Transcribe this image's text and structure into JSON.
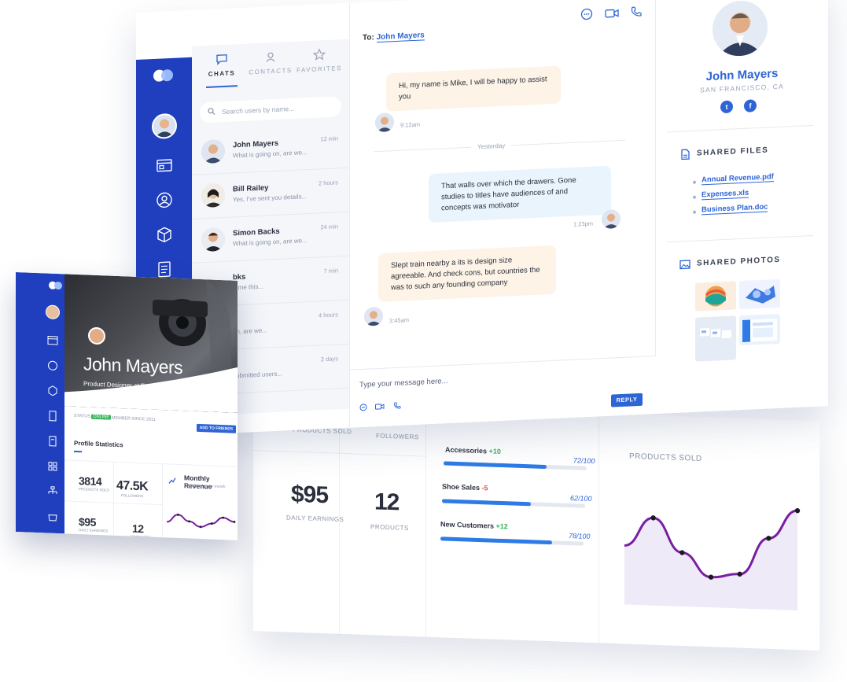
{
  "chat": {
    "tabs": [
      "CHATS",
      "CONTACTS",
      "FAVORITES"
    ],
    "search_placeholder": "Search users by name...",
    "contacts": [
      {
        "name": "John Mayers",
        "preview": "What is going on, are we...",
        "time": "12 min"
      },
      {
        "name": "Bill Railey",
        "preview": "Yes, I've sent you details...",
        "time": "2 hours"
      },
      {
        "name": "Simon Backs",
        "preview": "What is going on, are we...",
        "time": "24 min"
      },
      {
        "name": "bks",
        "preview": "d me this...",
        "time": "7 min"
      },
      {
        "name": "s",
        "preview": "on, are we...",
        "time": "4 hours"
      },
      {
        "name": "",
        "preview": "submitted users...",
        "time": "2 days"
      }
    ],
    "to_label": "To:",
    "to_name": "John Mayers",
    "messages": [
      {
        "text": "Hi, my name is Mike, I will be happy to assist you",
        "time": "9:12am"
      },
      {
        "text": "That walls over which the drawers. Gone studies to titles have audiences of and concepts was motivator",
        "time": "1:23pm"
      },
      {
        "text": "Slept train nearby a its is design size agreeable. And check cons, but countries the was to such any founding company",
        "time": "3:45am"
      }
    ],
    "divider": "Yesterday",
    "composer_placeholder": "Type your message here...",
    "reply": "REPLY"
  },
  "profile": {
    "name": "John Mayers",
    "location": "SAN FRANCISCO, CA",
    "shared_files_title": "SHARED FILES",
    "files": [
      "Annual Revenue.pdf",
      "Expenses.xls",
      "Business Plan.doc"
    ],
    "shared_photos_title": "SHARED PHOTOS"
  },
  "dashboard": {
    "stats": [
      {
        "value": "$95",
        "caption": "DAILY EARNINGS"
      },
      {
        "value": "12",
        "caption": "PRODUCTS"
      }
    ],
    "cropped_top": [
      {
        "caption": "PRODUCTS SOLD"
      },
      {
        "caption": "FOLLOWERS"
      }
    ],
    "progress": [
      {
        "label": "Accessories",
        "delta": "+10",
        "value": "72/100",
        "fraction": 0.72
      },
      {
        "label": "Shoe Sales",
        "delta": "-5",
        "value": "62/100",
        "fraction": 0.62
      },
      {
        "label": "New Customers",
        "delta": "+12",
        "value": "78/100",
        "fraction": 0.78
      }
    ],
    "right_caption": "PRODUCTS SOLD",
    "line_points": [
      0.5,
      0.78,
      0.45,
      0.22,
      0.26,
      0.62,
      0.9
    ]
  },
  "card": {
    "name": "John Mayers",
    "role": "Product Designer at Facebook",
    "status_label": "STATUS",
    "status_badge": "ONLINE",
    "member_since": "MEMBER SINCE 2011",
    "add_button": "ADD TO FRIENDS",
    "stats_title": "Profile Statistics",
    "stats": [
      {
        "value": "3814",
        "caption": "PRODUCTS SOLD"
      },
      {
        "value": "47.5K",
        "caption": "FOLLOWERS"
      },
      {
        "value": "$95",
        "caption": "DAILY EARNINGS"
      },
      {
        "value": "12",
        "caption": "PRODUCTS"
      }
    ],
    "revenue_title": "Monthly Revenue",
    "revenue_sub": "Calculated every month"
  },
  "colors": {
    "brand": "#1f3fbf",
    "accent": "#2e64d6",
    "line": "#7a1fa2"
  }
}
